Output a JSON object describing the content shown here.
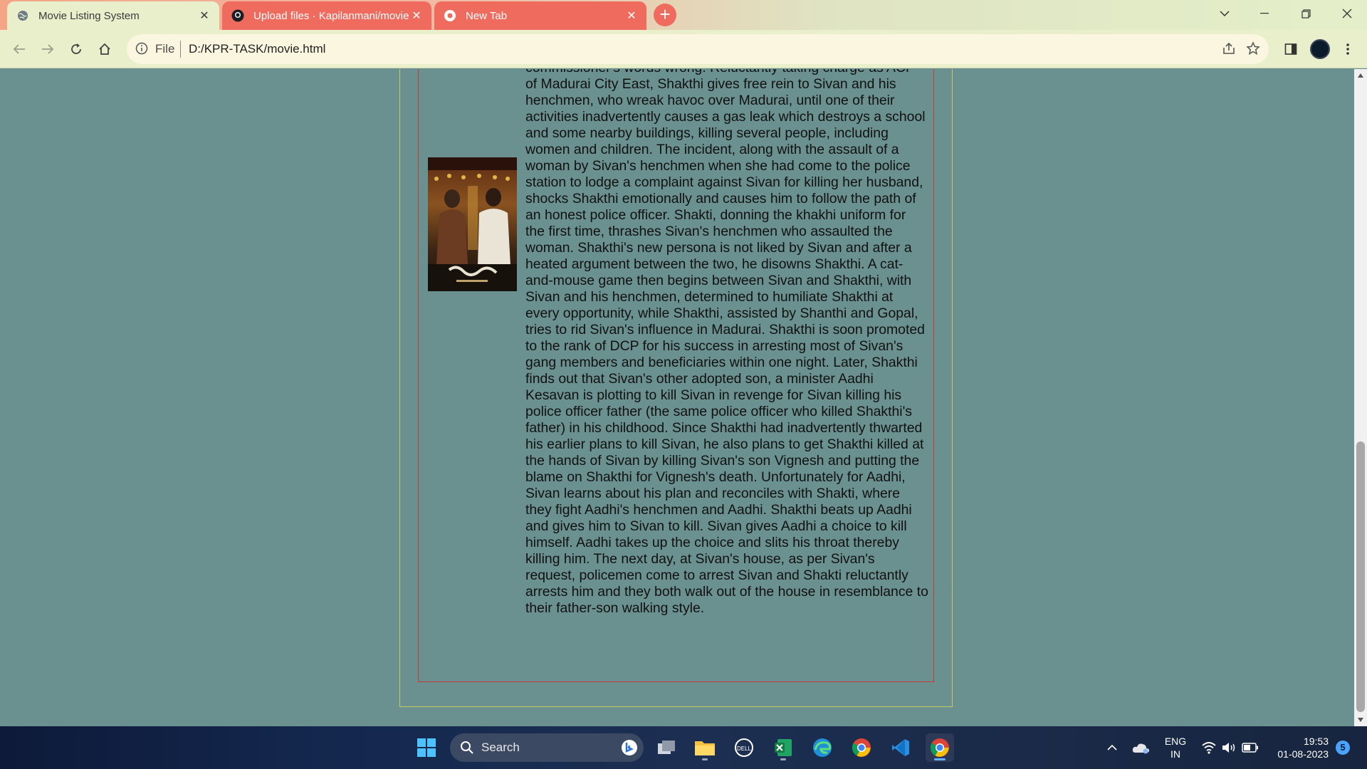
{
  "browser": {
    "tabs": [
      {
        "title": "Movie Listing System",
        "active": true
      },
      {
        "title": "Upload files · Kapilanmani/movie",
        "active": false
      },
      {
        "title": "New Tab",
        "active": false
      }
    ],
    "address": {
      "protocol": "File",
      "url": "D:/KPR-TASK/movie.html"
    }
  },
  "page": {
    "plot": "commissioner's words wrong. Reluctantly taking charge as ACP of Madurai City East, Shakthi gives free rein to Sivan and his henchmen, who wreak havoc over Madurai, until one of their activities inadvertently causes a gas leak which destroys a school and some nearby buildings, killing several people, including women and children. The incident, along with the assault of a woman by Sivan's henchmen when she had come to the police station to lodge a complaint against Sivan for killing her husband, shocks Shakthi emotionally and causes him to follow the path of an honest police officer. Shakti, donning the khakhi uniform for the first time, thrashes Sivan's henchmen who assaulted the woman. Shakthi's new persona is not liked by Sivan and after a heated argument between the two, he disowns Shakthi. A cat-and-mouse game then begins between Sivan and Shakthi, with Sivan and his henchmen, determined to humiliate Shakthi at every opportunity, while Shakthi, assisted by Shanthi and Gopal, tries to rid Sivan's influence in Madurai. Shakthi is soon promoted to the rank of DCP for his success in arresting most of Sivan's gang members and beneficiaries within one night. Later, Shakthi finds out that Sivan's other adopted son, a minister Aadhi Kesavan is plotting to kill Sivan in revenge for Sivan killing his police officer father (the same police officer who killed Shakthi's father) in his childhood. Since Shakthi had inadvertently thwarted his earlier plans to kill Sivan, he also plans to get Shakthi killed at the hands of Sivan by killing Sivan's son Vignesh and putting the blame on Shakthi for Vignesh's death. Unfortunately for Aadhi, Sivan learns about his plan and reconciles with Shakti, where they fight Aadhi's henchmen and Aadhi. Shakthi beats up Aadhi and gives him to Sivan to kill. Sivan gives Aadhi a choice to kill himself. Aadhi takes up the choice and slits his throat thereby killing him. The next day, at Sivan's house, as per Sivan's request, policemen come to arrest Sivan and Shakti reluctantly arrests him and they both walk out of the house in resemblance to their father-son walking style."
  },
  "taskbar": {
    "search_label": "Search",
    "language": "ENG",
    "region": "IN",
    "time": "19:53",
    "date": "01-08-2023",
    "notifications": "5"
  },
  "colors": {
    "page_bg": "#6a9190",
    "outer_border": "#c7cc62",
    "inner_border": "#c33a34",
    "tab_inactive": "#ee6b5e",
    "toolbar": "#e8efca"
  }
}
